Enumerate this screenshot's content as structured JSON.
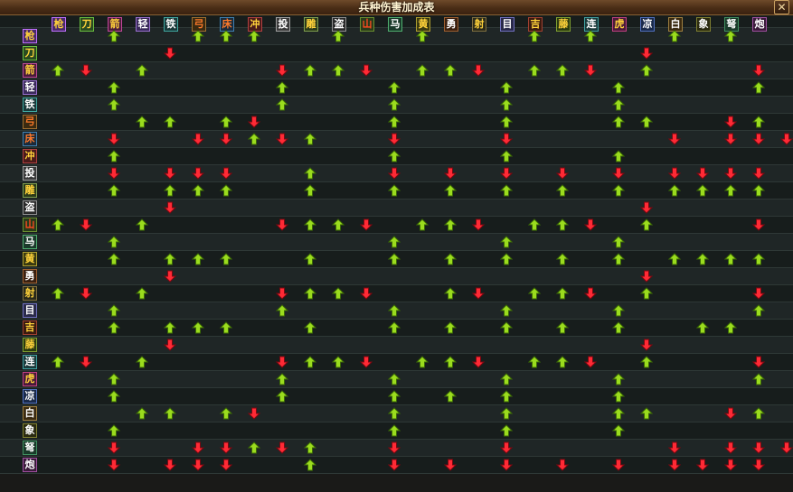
{
  "window": {
    "title": "兵种伤害加成表",
    "close_label": "✕"
  },
  "colors": {
    "up_fill": "#9bdc1e",
    "up_stroke": "#3c6a06",
    "down_fill": "#ff2a35",
    "down_stroke": "#7a0810"
  },
  "units": [
    {
      "name": "枪",
      "bg": "#4a2a6a",
      "border": "#c070ff",
      "color": "#ffd23a"
    },
    {
      "name": "刀",
      "bg": "#2a4a20",
      "border": "#6ac040",
      "color": "#ffd23a"
    },
    {
      "name": "箭",
      "bg": "#4a1a3a",
      "border": "#c04898",
      "color": "#ffd23a"
    },
    {
      "name": "轻",
      "bg": "#3a2a5a",
      "border": "#9a70d0",
      "color": "#ffffff"
    },
    {
      "name": "铁",
      "bg": "#1a3a3a",
      "border": "#40a8a0",
      "color": "#ffffff"
    },
    {
      "name": "弓",
      "bg": "#3a2a10",
      "border": "#a07030",
      "color": "#ff7a2a"
    },
    {
      "name": "床",
      "bg": "#1a2a3a",
      "border": "#4080b0",
      "color": "#ff7a2a"
    },
    {
      "name": "冲",
      "bg": "#4a1a1a",
      "border": "#b04040",
      "color": "#ffd23a"
    },
    {
      "name": "投",
      "bg": "#3a3a3a",
      "border": "#a0a0a0",
      "color": "#ffffff"
    },
    {
      "name": "雕",
      "bg": "#2a3a1a",
      "border": "#80a050",
      "color": "#ffd23a"
    },
    {
      "name": "盗",
      "bg": "#2a2a2a",
      "border": "#909090",
      "color": "#ffffff"
    },
    {
      "name": "山",
      "bg": "#2a3a1a",
      "border": "#6a9030",
      "color": "#ff4a20"
    },
    {
      "name": "马",
      "bg": "#1a3a2a",
      "border": "#50b070",
      "color": "#ffffff"
    },
    {
      "name": "黄",
      "bg": "#3a3a10",
      "border": "#b0a030",
      "color": "#ffd23a"
    },
    {
      "name": "勇",
      "bg": "#3a2010",
      "border": "#a06030",
      "color": "#ffffff"
    },
    {
      "name": "射",
      "bg": "#2a2a1a",
      "border": "#807040",
      "color": "#ffd23a"
    },
    {
      "name": "目",
      "bg": "#2a2a4a",
      "border": "#7070c0",
      "color": "#ffffff"
    },
    {
      "name": "吉",
      "bg": "#3a1a10",
      "border": "#a04030",
      "color": "#ffd23a"
    },
    {
      "name": "藤",
      "bg": "#2a3a10",
      "border": "#80a030",
      "color": "#ffd23a"
    },
    {
      "name": "连",
      "bg": "#1a3a3a",
      "border": "#40a0a0",
      "color": "#ffffff"
    },
    {
      "name": "虎",
      "bg": "#4a1a3a",
      "border": "#c04080",
      "color": "#ffd23a"
    },
    {
      "name": "凉",
      "bg": "#1a2a4a",
      "border": "#5070c0",
      "color": "#ffffff"
    },
    {
      "name": "白",
      "bg": "#3a2a10",
      "border": "#a08040",
      "color": "#ffffff"
    },
    {
      "name": "象",
      "bg": "#2a2a10",
      "border": "#808030",
      "color": "#ffffff"
    },
    {
      "name": "弩",
      "bg": "#1a3a2a",
      "border": "#409060",
      "color": "#ffffff"
    },
    {
      "name": "炮",
      "bg": "#3a1a3a",
      "border": "#a050a0",
      "color": "#ffffff"
    }
  ],
  "matrix": [
    "..U..UUU..U..U...U.U..U.U..",
    "....D................D.....",
    "UD.U....DUUD.UUD.UUD.U...D.U",
    "..U.....U...U...U...U....U..",
    "..U.....U...U...U...U......",
    "...UU.UD....U...U...UU..DU.",
    "..D..DDUDU..D...D.....D.DDDUU",
    "..U.........U...U...U......",
    "..D.DDD..U..D.D.D.D.D.DDDD.",
    "..U.UUU..U..U.U.U.U.U.UUUU.",
    "....D................D.....",
    "UD.U....DUUD.UUD.UUD.U...D.U",
    "..U.........U...U...U......",
    "..U.UUU..U..U.U.U.U.U.UUUU.",
    "....D................D.....",
    "UD.U....DUUD..UD.UUD.U...D.U",
    "..U.....U...U...U...U....U..",
    "..U.UUU..U..U.U.U.U.U..UU..",
    "....D................D.....",
    "UD.U....DUUD.UUD.UUD.U...D.U",
    "..U.....U...U...U...U....U..",
    "..U.....U...U.U.U...U......",
    "...UU.UD....U...U...UU..DU.",
    "..U.........U...U...U......",
    "..D..DDUDU..D...D.....D.DDDUU",
    "..D.DDD..U..D.D.D.D.D.DDDD."
  ]
}
